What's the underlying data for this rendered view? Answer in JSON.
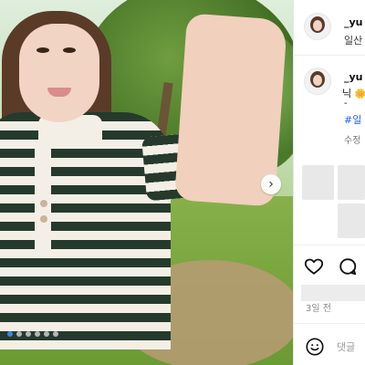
{
  "post": {
    "header": {
      "username": "_yu",
      "location": "일산"
    },
    "caption": {
      "username": "_yu",
      "text": "닉",
      "emoji": "🌼",
      "dash": "-",
      "hashtag": "#일",
      "edited_label": "수정"
    },
    "media": {
      "carousel_dots": 6,
      "active_dot": 0
    },
    "actions": {
      "like_icon": "heart-icon",
      "comment_icon": "comment-icon"
    },
    "time_ago": "3일 전",
    "comment_input": {
      "placeholder": "댓글"
    }
  }
}
